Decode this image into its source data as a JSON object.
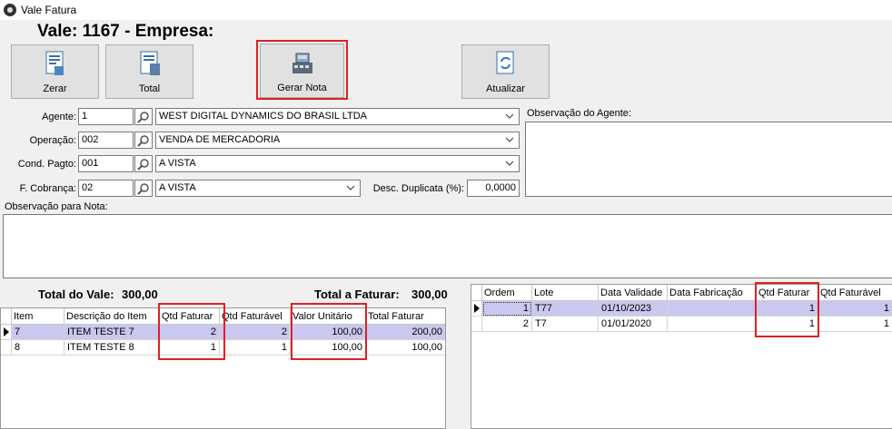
{
  "window": {
    "title": "Vale Fatura"
  },
  "header": {
    "title": "Vale: 1167 - Empresa:"
  },
  "toolbar": {
    "zerar": "Zerar",
    "total": "Total",
    "gerar_nota": "Gerar Nota",
    "atualizar": "Atualizar"
  },
  "form": {
    "agente": {
      "label": "Agente:",
      "code": "1",
      "value": "WEST DIGITAL DYNAMICS DO BRASIL LTDA"
    },
    "operacao": {
      "label": "Operação:",
      "code": "002",
      "value": "VENDA DE MERCADORIA"
    },
    "cond_pagto": {
      "label": "Cond. Pagto:",
      "code": "001",
      "value": "A VISTA"
    },
    "f_cobranca": {
      "label": "F. Cobrança:",
      "code": "02",
      "value": "A VISTA"
    },
    "desc_duplicata": {
      "label": "Desc. Duplicata (%):",
      "value": "0,0000"
    },
    "obs_agente_label": "Observação do Agente:",
    "obs_nota_label": "Observação para Nota:"
  },
  "totals": {
    "vale_label": "Total do Vale:",
    "vale_value": "300,00",
    "faturar_label": "Total a Faturar:",
    "faturar_value": "300,00"
  },
  "items_grid": {
    "columns": [
      "Item",
      "Descrição do Item",
      "Qtd Faturar",
      "Qtd Faturável",
      "Valor Unitário",
      "Total Faturar"
    ],
    "rows": [
      [
        "7",
        "ITEM TESTE 7",
        "2",
        "2",
        "100,00",
        "200,00"
      ],
      [
        "8",
        "ITEM TESTE 8",
        "1",
        "1",
        "100,00",
        "100,00"
      ]
    ]
  },
  "lots_grid": {
    "columns": [
      "Ordem",
      "Lote",
      "Data Validade",
      "Data Fabricação",
      "Qtd Faturar",
      "Qtd Faturável"
    ],
    "rows": [
      [
        "1",
        "T77",
        "01/10/2023",
        "",
        "1",
        "1"
      ],
      [
        "2",
        "T7",
        "01/01/2020",
        "",
        "1",
        "1"
      ]
    ]
  },
  "colors": {
    "highlight": "#e02020",
    "selected_row": "#c8c8f0"
  }
}
